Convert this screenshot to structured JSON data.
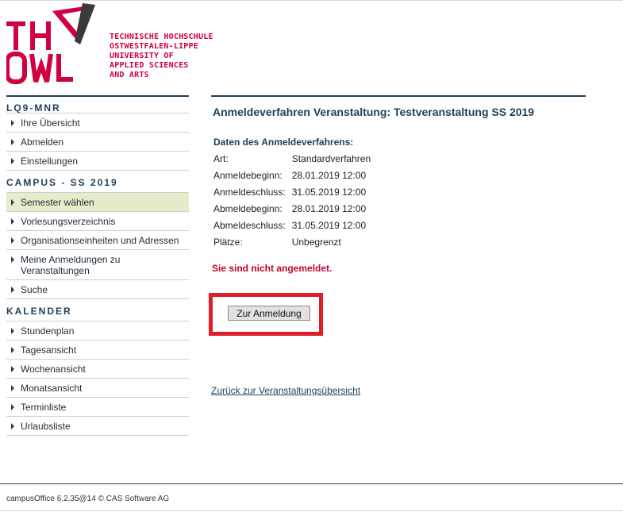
{
  "logo": {
    "letters_top": "TH",
    "letters_bottom": "OWL",
    "lines": [
      "TECHNISCHE HOCHSCHULE",
      "OSTWESTFALEN-LIPPE",
      "UNIVERSITY OF",
      "APPLIED SCIENCES",
      "AND ARTS"
    ]
  },
  "sidebar": {
    "user_section": "LQ9-MNR",
    "user_items": [
      "Ihre Übersicht",
      "Abmelden",
      "Einstellungen"
    ],
    "campus_section": "CAMPUS - SS 2019",
    "campus_items": [
      "Semester wählen",
      "Vorlesungsverzeichnis",
      "Organisationseinheiten und Adressen",
      "Meine Anmeldungen zu Veranstaltungen",
      "Suche"
    ],
    "calendar_section": "KALENDER",
    "calendar_items": [
      "Stundenplan",
      "Tagesansicht",
      "Wochenansicht",
      "Monatsansicht",
      "Terminliste",
      "Urlaubsliste"
    ]
  },
  "main": {
    "title": "Anmeldeverfahren Veranstaltung: Testveranstaltung SS 2019",
    "data_heading": "Daten des Anmeldeverfahrens:",
    "rows": [
      {
        "label": "Art:",
        "value": "Standardverfahren"
      },
      {
        "label": "Anmeldebeginn:",
        "value": "28.01.2019 12:00"
      },
      {
        "label": "Anmeldeschluss:",
        "value": "31.05.2019 12:00"
      },
      {
        "label": "Abmeldebeginn:",
        "value": "28.01.2019 12:00"
      },
      {
        "label": "Abmeldeschluss:",
        "value": "31.05.2019 12:00"
      },
      {
        "label": "Plätze:",
        "value": "Unbegrenzt"
      }
    ],
    "status": "Sie sind nicht angemeldet.",
    "button_label": "Zur Anmeldung",
    "back_link": "Zurück zur Veranstaltungsübersicht"
  },
  "footer": {
    "text": "campusOffice 6.2.35@14 © CAS Software AG"
  },
  "colors": {
    "brand": "#d1003e",
    "navy": "#1e3f5a",
    "active_bg": "#e4eccc",
    "highlight": "#e01e2a",
    "triangle_dark": "#3a3a3a"
  }
}
